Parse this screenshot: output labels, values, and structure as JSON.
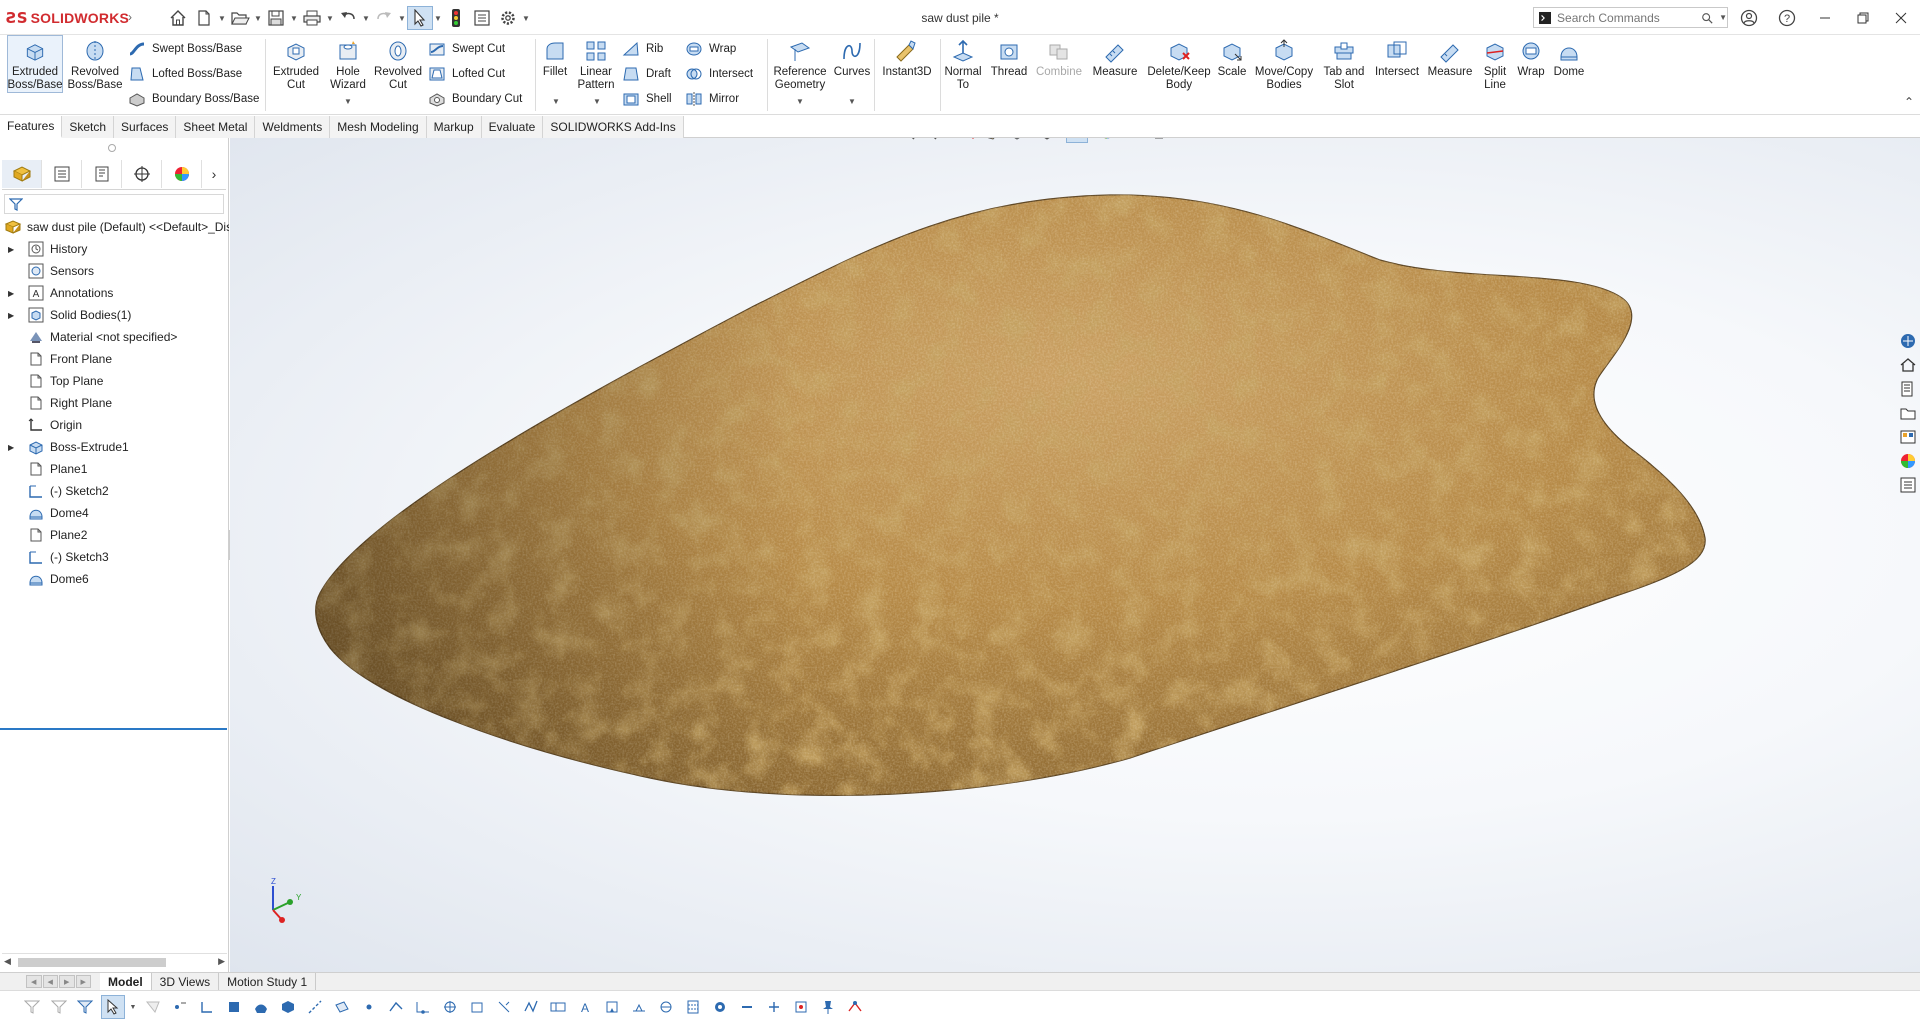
{
  "app": {
    "brand": "SOLIDWORKS",
    "document_title": "saw dust pile *"
  },
  "search": {
    "placeholder": "Search Commands"
  },
  "ribbon": {
    "extruded_boss": "Extruded Boss/Base",
    "revolved_boss": "Revolved Boss/Base",
    "swept_boss": "Swept Boss/Base",
    "lofted_boss": "Lofted Boss/Base",
    "boundary_boss": "Boundary Boss/Base",
    "extruded_cut": "Extruded Cut",
    "hole_wizard": "Hole Wizard",
    "revolved_cut": "Revolved Cut",
    "swept_cut": "Swept Cut",
    "lofted_cut": "Lofted Cut",
    "boundary_cut": "Boundary Cut",
    "fillet": "Fillet",
    "linear_pattern": "Linear Pattern",
    "rib": "Rib",
    "draft": "Draft",
    "shell": "Shell",
    "wrap": "Wrap",
    "intersect": "Intersect",
    "mirror": "Mirror",
    "reference_geometry": "Reference Geometry",
    "curves": "Curves",
    "instant3d": "Instant3D",
    "normal_to": "Normal To",
    "thread": "Thread",
    "combine": "Combine",
    "measure": "Measure",
    "delete_keep_body": "Delete/Keep Body",
    "scale": "Scale",
    "move_copy_bodies": "Move/Copy Bodies",
    "tab_and_slot": "Tab and Slot",
    "intersect2": "Intersect",
    "measure2": "Measure",
    "split_line": "Split Line",
    "wrap2": "Wrap",
    "dome": "Dome"
  },
  "tabs": [
    "Features",
    "Sketch",
    "Surfaces",
    "Sheet Metal",
    "Weldments",
    "Mesh Modeling",
    "Markup",
    "Evaluate",
    "SOLIDWORKS Add-Ins"
  ],
  "tree": {
    "root": "saw dust pile (Default) <<Default>_Dis",
    "items": [
      "History",
      "Sensors",
      "Annotations",
      "Solid Bodies(1)",
      "Material <not specified>",
      "Front Plane",
      "Top Plane",
      "Right Plane",
      "Origin",
      "Boss-Extrude1",
      "Plane1",
      "(-) Sketch2",
      "Dome4",
      "Plane2",
      "(-) Sketch3",
      "Dome6"
    ]
  },
  "bottom_tabs": [
    "Model",
    "3D Views",
    "Motion Study 1"
  ],
  "triad": {
    "z": "Z",
    "y": "Y"
  },
  "colors": {
    "accent": "#d12b2f",
    "selection": "#2a79c6",
    "sawdust": "#b98a45"
  }
}
